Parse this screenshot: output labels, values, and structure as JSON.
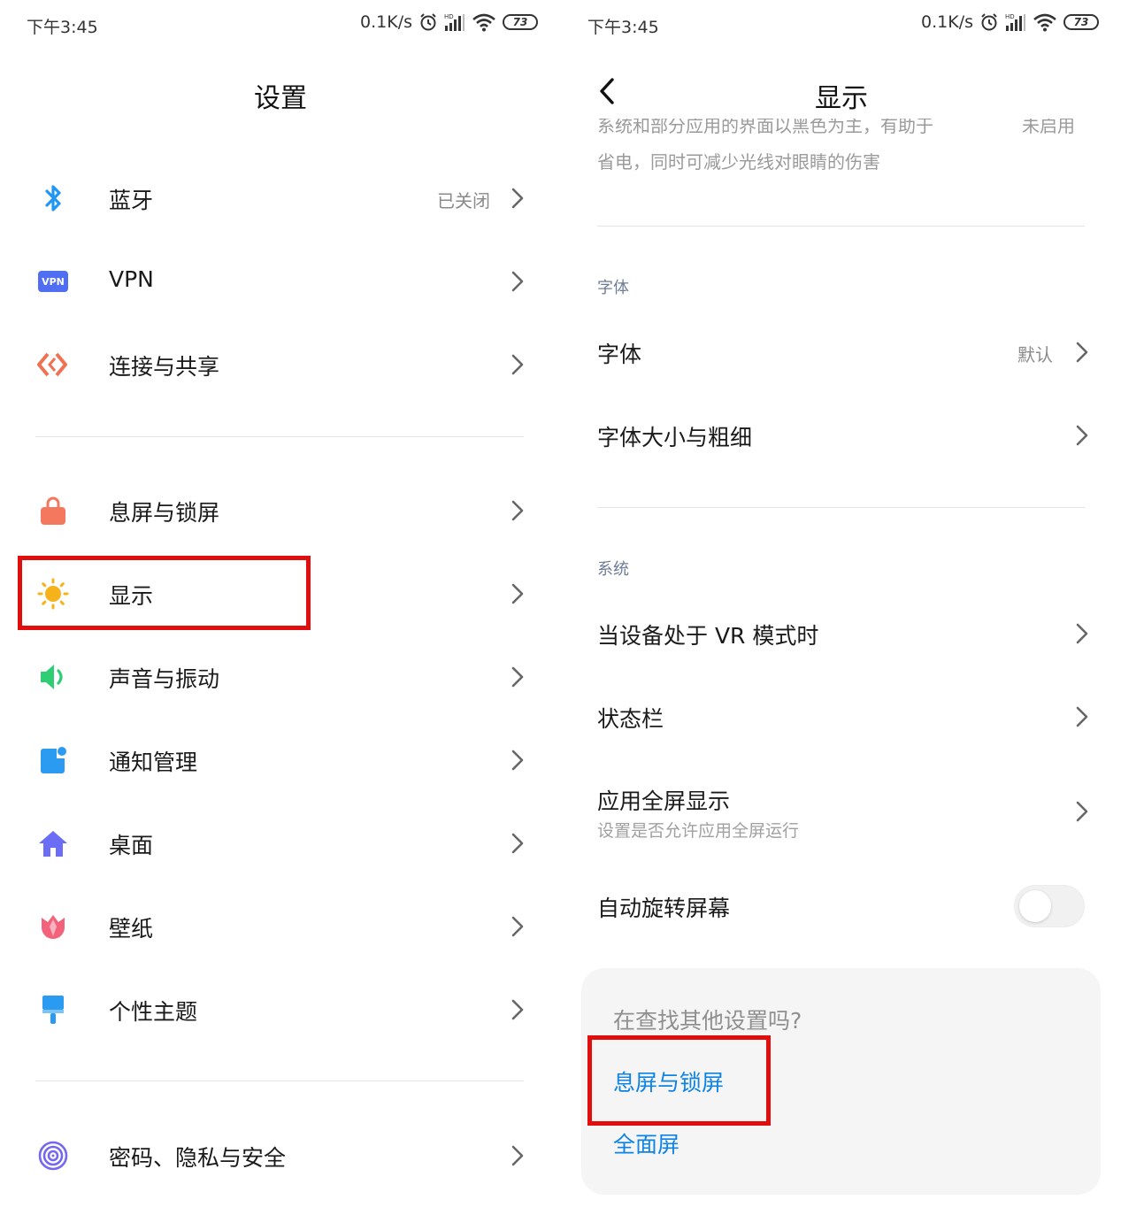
{
  "left": {
    "status": {
      "time": "下午3:45",
      "net_speed": "0.1K/s",
      "battery": "73"
    },
    "title": "设置",
    "items": [
      {
        "label": "蓝牙",
        "value": "已关闭",
        "icon": "bluetooth-icon"
      },
      {
        "label": "VPN",
        "icon": "vpn-icon",
        "icon_text": "VPN"
      },
      {
        "label": "连接与共享",
        "icon": "connection-share-icon"
      },
      {
        "label": "息屏与锁屏",
        "icon": "lock-icon"
      },
      {
        "label": "显示",
        "icon": "sun-icon"
      },
      {
        "label": "声音与振动",
        "icon": "speaker-icon"
      },
      {
        "label": "通知管理",
        "icon": "notification-icon"
      },
      {
        "label": "桌面",
        "icon": "home-icon"
      },
      {
        "label": "壁纸",
        "icon": "tulip-icon"
      },
      {
        "label": "个性主题",
        "icon": "paint-brush-icon"
      },
      {
        "label": "密码、隐私与安全",
        "icon": "fingerprint-icon"
      }
    ]
  },
  "right": {
    "status": {
      "time": "下午3:45",
      "net_speed": "0.1K/s",
      "battery": "73"
    },
    "title": "显示",
    "top_fragment": {
      "line1": "系统和部分应用的界面以黑色为主，有助于",
      "line1_value": "未启用",
      "line2": "省电，同时可减少光线对眼睛的伤害"
    },
    "font_section": {
      "header": "字体",
      "items": [
        {
          "label": "字体",
          "value": "默认"
        },
        {
          "label": "字体大小与粗细"
        }
      ]
    },
    "system_section": {
      "header": "系统",
      "items": [
        {
          "label": "当设备处于 VR 模式时"
        },
        {
          "label": "状态栏"
        },
        {
          "label": "应用全屏显示",
          "sub": "设置是否允许应用全屏运行"
        },
        {
          "label": "自动旋转屏幕",
          "toggle": false
        }
      ]
    },
    "search_card": {
      "question": "在查找其他设置吗?",
      "links": [
        "息屏与锁屏",
        "全面屏"
      ]
    }
  },
  "colors": {
    "highlight_box": "#e10e0e",
    "link": "#0f83e4",
    "section_header": "#6d7b97"
  }
}
